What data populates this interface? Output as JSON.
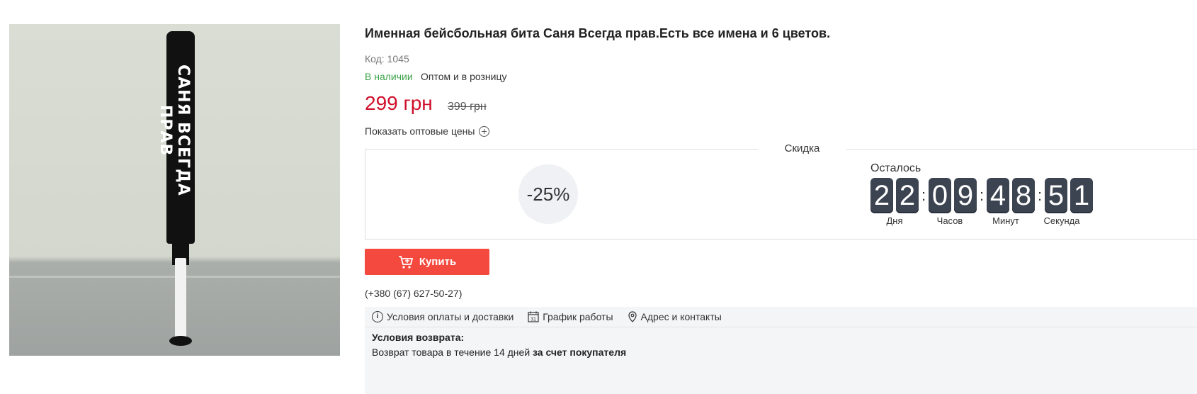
{
  "product": {
    "title": "Именная бейсбольная бита Саня Всегда прав.Есть все имена и 6 цветов.",
    "code": "Код: 1045",
    "availability": "В наличии",
    "sale_type": "Оптом и в розницу",
    "price": "299 грн",
    "old_price": "399 грн",
    "show_wholesale_label": "Показать оптовые цены",
    "image_text": "САНЯ ВСЕГДА ПРАВ"
  },
  "discount": {
    "label": "Скидка",
    "percent": "-25%",
    "remaining_label": "Осталось",
    "digits": [
      "2",
      "2",
      "0",
      "9",
      "4",
      "8",
      "5",
      "1"
    ],
    "units": [
      "Дня",
      "Часов",
      "Минут",
      "Секунда"
    ]
  },
  "buy_button": {
    "label": "Купить",
    "color": "#f4493f"
  },
  "phone": "(+380 (67) 627-50-27)",
  "tabs": [
    {
      "label": "Условия оплаты и доставки",
      "icon": "info-icon"
    },
    {
      "label": "График работы",
      "icon": "calendar-icon",
      "icon_text": "31"
    },
    {
      "label": "Адрес и контакты",
      "icon": "map-pin-icon"
    }
  ],
  "returns": {
    "title": "Условия возврата:",
    "text_prefix": "Возврат товара в течение 14 дней",
    "text_bold": "за счет покупателя"
  },
  "colors": {
    "price": "#d0102b",
    "in_stock": "#3ca34a",
    "timer_digit_bg": "#3c4452"
  }
}
